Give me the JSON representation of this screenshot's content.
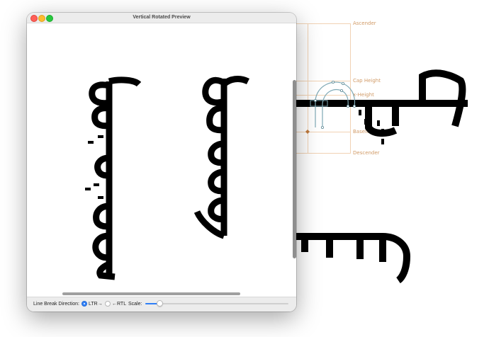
{
  "editor": {
    "metrics": [
      {
        "label": "Ascender"
      },
      {
        "label": "Cap Height"
      },
      {
        "label": "x-Height"
      },
      {
        "label": "Baseline"
      },
      {
        "label": "Descender"
      }
    ],
    "colors": {
      "metric": "#d19a66",
      "outline": "#7fa9b5",
      "glyph": "#000000"
    }
  },
  "window": {
    "title": "Vertical Rotated Preview",
    "line_break_label": "Line Break Direction:",
    "option_ltr": "LTR→",
    "option_rtl": "←RTL",
    "selected": "LTR→",
    "scale_label": "Scale:",
    "scale_level": 0.1,
    "accent": "#2f7ff7"
  }
}
